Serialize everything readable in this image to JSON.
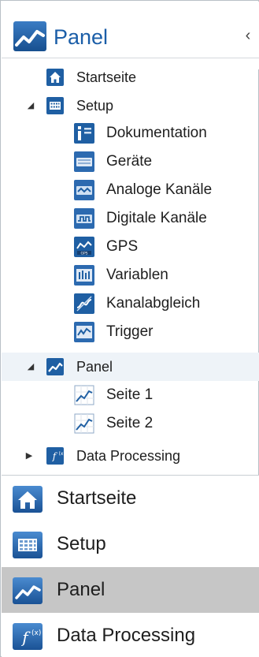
{
  "header": {
    "title": "Panel",
    "collapse_glyph": "‹"
  },
  "tree": [
    {
      "label": "Startseite",
      "icon": "home-icon",
      "level": 0,
      "arrow": ""
    },
    {
      "label": "Setup",
      "icon": "setup-grid-icon",
      "level": 0,
      "arrow": "◢"
    },
    {
      "label": "Dokumentation",
      "icon": "documentation-icon",
      "level": 1,
      "arrow": ""
    },
    {
      "label": "Geräte",
      "icon": "devices-icon",
      "level": 1,
      "arrow": ""
    },
    {
      "label": "Analoge Kanäle",
      "icon": "analog-channels-icon",
      "level": 1,
      "arrow": ""
    },
    {
      "label": "Digitale Kanäle",
      "icon": "digital-channels-icon",
      "level": 1,
      "arrow": ""
    },
    {
      "label": "GPS",
      "icon": "gps-icon",
      "level": 1,
      "arrow": ""
    },
    {
      "label": "Variablen",
      "icon": "variables-icon",
      "level": 1,
      "arrow": ""
    },
    {
      "label": "Kanalabgleich",
      "icon": "channel-calibration-icon",
      "level": 1,
      "arrow": ""
    },
    {
      "label": "Trigger",
      "icon": "trigger-icon",
      "level": 1,
      "arrow": ""
    },
    {
      "label": "Panel",
      "icon": "panel-chart-icon",
      "level": 0,
      "arrow": "◢",
      "selected": true
    },
    {
      "label": "Seite 1",
      "icon": "page-chart-icon",
      "level": 1,
      "arrow": ""
    },
    {
      "label": "Seite 2",
      "icon": "page-chart-icon",
      "level": 1,
      "arrow": ""
    },
    {
      "label": "Data Processing",
      "icon": "data-processing-icon",
      "level": 0,
      "arrow": "▶"
    }
  ],
  "nav": [
    {
      "label": "Startseite",
      "icon": "home-icon"
    },
    {
      "label": "Setup",
      "icon": "setup-grid-icon"
    },
    {
      "label": "Panel",
      "icon": "panel-chart-icon",
      "active": true
    },
    {
      "label": "Data Processing",
      "icon": "data-processing-icon"
    }
  ],
  "colors": {
    "accent": "#1b5ea8",
    "icon_blue": "#1f5fa3",
    "selected_nav": "#c6c6c6"
  }
}
